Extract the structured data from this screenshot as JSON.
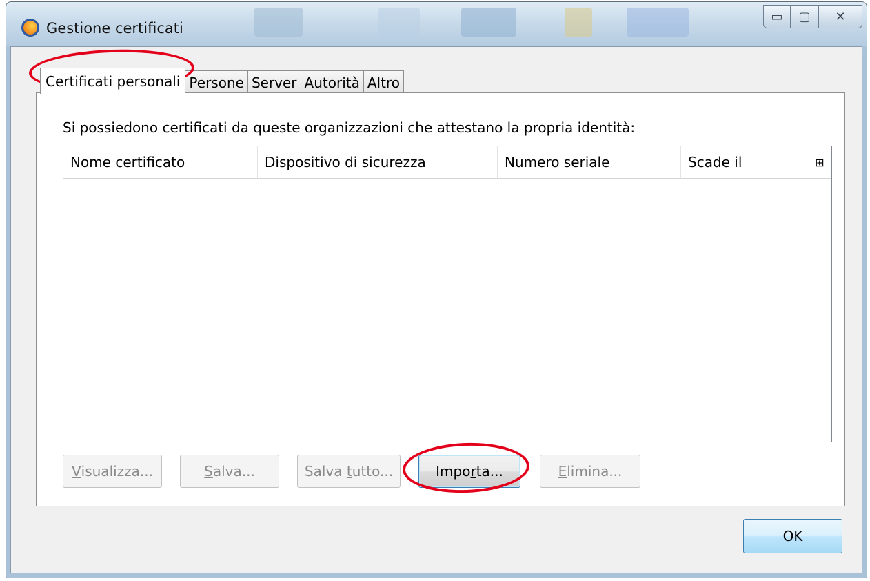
{
  "window": {
    "title": "Gestione certificati",
    "controls": {
      "minimize": "▭",
      "maximize": "▢",
      "close": "✕"
    }
  },
  "tabs": [
    {
      "label": "Certificati personali",
      "active": true
    },
    {
      "label": "Persone",
      "active": false
    },
    {
      "label": "Server",
      "active": false
    },
    {
      "label": "Autorità",
      "active": false
    },
    {
      "label": "Altro",
      "active": false
    }
  ],
  "panel": {
    "description": "Si possiedono certificati da queste organizzazioni che attestano la propria identità:",
    "columns": [
      "Nome certificato",
      "Dispositivo di sicurezza",
      "Numero seriale",
      "Scade il"
    ],
    "column_picker": "⊞"
  },
  "buttons": {
    "view": {
      "pre": "",
      "key": "V",
      "post": "isualizza..."
    },
    "save": {
      "pre": "",
      "key": "S",
      "post": "alva..."
    },
    "save_all": {
      "pre": "Salva ",
      "key": "t",
      "post": "utto..."
    },
    "import": {
      "pre": "Impo",
      "key": "r",
      "post": "ta..."
    },
    "delete": {
      "pre": "",
      "key": "E",
      "post": "limina..."
    },
    "ok": "OK"
  },
  "colors": {
    "highlight": "#e3001b",
    "accent": "#3c7fb1"
  }
}
